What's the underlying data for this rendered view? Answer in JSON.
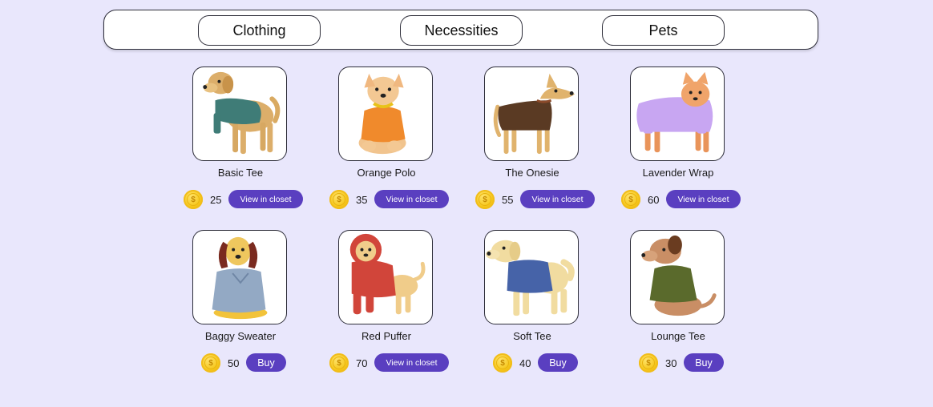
{
  "nav": {
    "tabs": [
      {
        "label": "Clothing"
      },
      {
        "label": "Necessities"
      },
      {
        "label": "Pets"
      }
    ]
  },
  "currency_icon": "coin-icon",
  "colors": {
    "background": "#e9e7fc",
    "button": "#5a3fc0",
    "coin": "#f5c518"
  },
  "items": [
    {
      "name": "Basic Tee",
      "price": "25",
      "action": "View in closet",
      "dog": "golden-retriever-teal-sweater"
    },
    {
      "name": "Orange Polo",
      "price": "35",
      "action": "View in closet",
      "dog": "corgi-orange-polo"
    },
    {
      "name": "The Onesie",
      "price": "55",
      "action": "View in closet",
      "dog": "dog-brown-onesie"
    },
    {
      "name": "Lavender Wrap",
      "price": "60",
      "action": "View in closet",
      "dog": "shiba-lavender-wrap"
    },
    {
      "name": "Baggy Sweater",
      "price": "50",
      "action": "Buy",
      "dog": "spaniel-baggy-sweater"
    },
    {
      "name": "Red Puffer",
      "price": "70",
      "action": "View in closet",
      "dog": "dog-red-puffer"
    },
    {
      "name": "Soft Tee",
      "price": "40",
      "action": "Buy",
      "dog": "labrador-blue-tee"
    },
    {
      "name": "Lounge Tee",
      "price": "30",
      "action": "Buy",
      "dog": "brown-dog-olive-tee"
    }
  ]
}
